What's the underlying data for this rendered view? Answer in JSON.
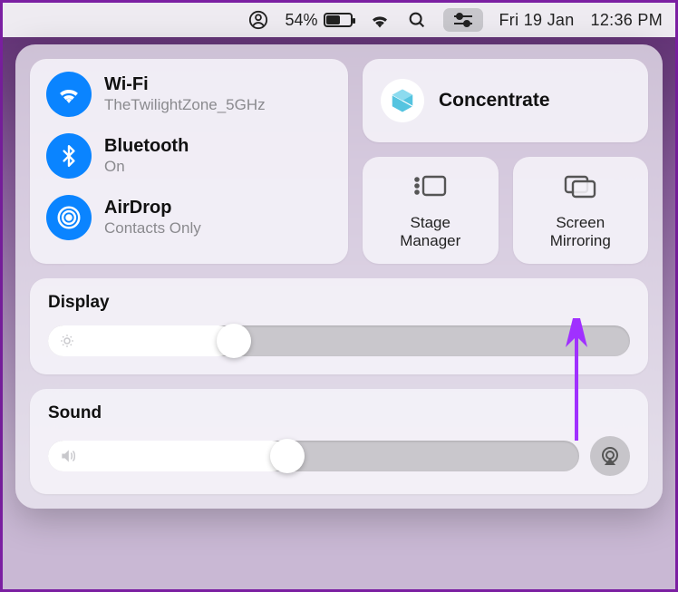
{
  "menubar": {
    "battery_pct": "54%",
    "date": "Fri 19 Jan",
    "time": "12:36 PM"
  },
  "connectivity": {
    "wifi": {
      "title": "Wi-Fi",
      "sub": "TheTwilightZone_5GHz"
    },
    "bluetooth": {
      "title": "Bluetooth",
      "sub": "On"
    },
    "airdrop": {
      "title": "AirDrop",
      "sub": "Contacts Only"
    }
  },
  "focus": {
    "label": "Concentrate"
  },
  "modules": {
    "stage_manager": "Stage\nManager",
    "screen_mirroring": "Screen\nMirroring"
  },
  "display": {
    "title": "Display",
    "value_pct": 32
  },
  "sound": {
    "title": "Sound",
    "value_pct": 45
  }
}
